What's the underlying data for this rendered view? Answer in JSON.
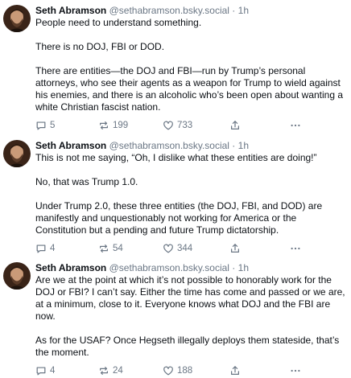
{
  "posts": [
    {
      "author_name": "Seth Abramson",
      "author_handle": "@sethabramson.bsky.social",
      "separator": "·",
      "time": "1h",
      "paragraphs": [
        "People need to understand something.",
        "There is no DOJ, FBI or DOD.",
        "There are entities—the DOJ and FBI—run by Trump’s personal attorneys, who see their agents as a weapon for Trump to wield against his enemies, and there is an alcoholic who’s been open about wanting a white Christian fascist nation."
      ],
      "replies": "5",
      "reposts": "199",
      "likes": "733"
    },
    {
      "author_name": "Seth Abramson",
      "author_handle": "@sethabramson.bsky.social",
      "separator": "·",
      "time": "1h",
      "paragraphs": [
        "This is not me saying, “Oh, I dislike what these entities are doing!”",
        "No, that was Trump 1.0.",
        "Under Trump 2.0, these three entities (the DOJ, FBI, and DOD) are manifestly and unquestionably not working for America or the Constitution but a pending and future Trump dictatorship."
      ],
      "replies": "4",
      "reposts": "54",
      "likes": "344"
    },
    {
      "author_name": "Seth Abramson",
      "author_handle": "@sethabramson.bsky.social",
      "separator": "·",
      "time": "1h",
      "paragraphs": [
        "Are we at the point at which it’s not possible to honorably work for the DOJ or FBI? I can’t say. Either the time has come and passed or we are, at a minimum, close to it. Everyone knows what DOJ and the FBI are now.",
        "As for the USAF? Once Hegseth illegally deploys them stateside, that’s the moment."
      ],
      "replies": "4",
      "reposts": "24",
      "likes": "188"
    }
  ],
  "icons": {
    "reply": "reply-icon",
    "repost": "repost-icon",
    "like": "like-icon",
    "share": "share-icon",
    "more": "more-icon"
  },
  "colors": {
    "text": "#0b0f14",
    "muted": "#6b7785",
    "background": "#ffffff"
  }
}
